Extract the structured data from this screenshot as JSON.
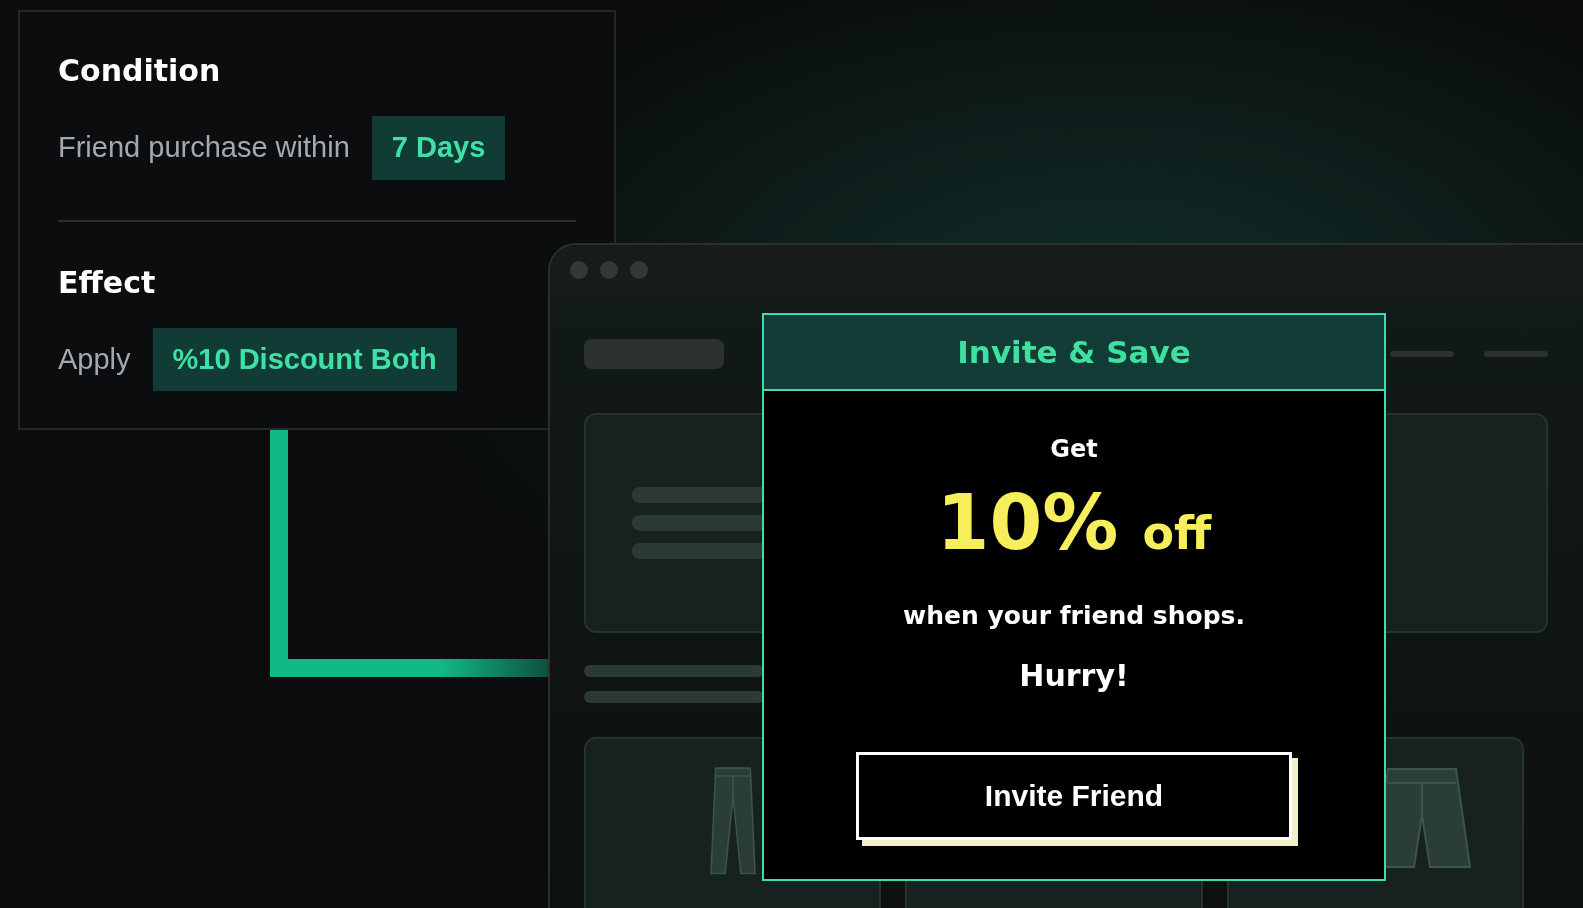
{
  "rule_card": {
    "sections": [
      {
        "title": "Condition",
        "label": "Friend purchase within",
        "value": "7 Days"
      },
      {
        "title": "Effect",
        "label": "Apply",
        "value": "%10 Discount Both"
      }
    ]
  },
  "popup": {
    "title": "Invite & Save",
    "lead": "Get",
    "amount": "10%",
    "amount_suffix": "off",
    "message": "when your friend shops.",
    "urgency": "Hurry!",
    "button": "Invite Friend"
  }
}
